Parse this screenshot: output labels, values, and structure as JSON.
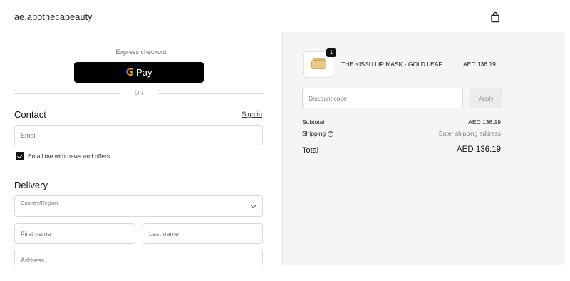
{
  "header": {
    "brand": "ae.apothecabeauty",
    "cart_icon": "shopping-bag-icon"
  },
  "express": {
    "title": "Express checkout",
    "gpay_g": "G",
    "gpay_label": "Pay"
  },
  "divider": {
    "or": "OR"
  },
  "contact": {
    "heading": "Contact",
    "sign_in": "Sign in",
    "email_placeholder": "Email",
    "news_label": "Email me with news and offers",
    "news_checked": true
  },
  "delivery": {
    "heading": "Delivery",
    "country_label": "Country/Region",
    "first_name_placeholder": "First name",
    "last_name_placeholder": "Last name",
    "address_placeholder": "Address"
  },
  "order": {
    "product_name": "THE KISSU LIP MASK - GOLD LEAF",
    "product_price": "AED 136.19",
    "quantity": "1",
    "discount_placeholder": "Discount code",
    "apply_label": "Apply",
    "subtotal_label": "Subtotal",
    "subtotal_value": "AED 136.19",
    "shipping_label": "Shipping",
    "shipping_value": "Enter shipping address",
    "total_label": "Total",
    "total_value": "AED 136.19"
  },
  "colors": {
    "accent": "#111111",
    "summary_bg": "#f5f5f5"
  }
}
